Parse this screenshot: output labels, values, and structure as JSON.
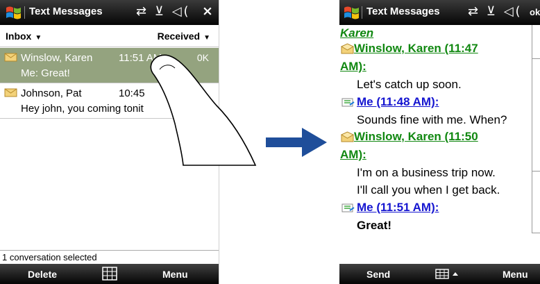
{
  "left_phone": {
    "title": "Text Messages",
    "status_icons": "⇄ ⊻ ◁(",
    "close_label": "×",
    "filter_left": "Inbox",
    "filter_right": "Received",
    "messages": [
      {
        "name": "Winslow, Karen",
        "time": "11:51 AM",
        "size": "0K",
        "preview": "Me: Great!",
        "selected": true
      },
      {
        "name": "Johnson, Pat",
        "time": "10:45",
        "size": "",
        "preview": "Hey john, you coming tonit",
        "selected": false
      }
    ],
    "status_text": "1 conversation selected",
    "softkey_left": "Delete",
    "softkey_right": "Menu"
  },
  "right_phone": {
    "title": "Text Messages",
    "status_icons": "⇄ ⊻ ◁(",
    "ok_label": "ok",
    "contact": "Karen",
    "conversation": [
      {
        "sender": "Winslow, Karen (11:47",
        "sender_cont": "AM):",
        "from": "them",
        "text": [
          "Let's catch up soon."
        ]
      },
      {
        "sender": "Me (11:48 AM):",
        "from": "me",
        "text": [
          "Sounds fine with me. When?"
        ]
      },
      {
        "sender": "Winslow, Karen (11:50",
        "sender_cont": "AM):",
        "from": "them",
        "text": [
          "I'm on a business trip now.",
          "I'll call you when I get back."
        ]
      },
      {
        "sender": "Me (11:51 AM):",
        "from": "me",
        "text": [
          "Great!"
        ]
      }
    ],
    "softkey_left": "Send",
    "softkey_right": "Menu"
  },
  "colors": {
    "selected_row": "#94a37f",
    "them_link": "#118811",
    "me_link": "#1515d0",
    "arrow": "#1f4e9a"
  },
  "icons": [
    "windows-flag-icon",
    "envelope-icon",
    "keyboard-icon",
    "arrow-right-icon",
    "finger-icon"
  ]
}
